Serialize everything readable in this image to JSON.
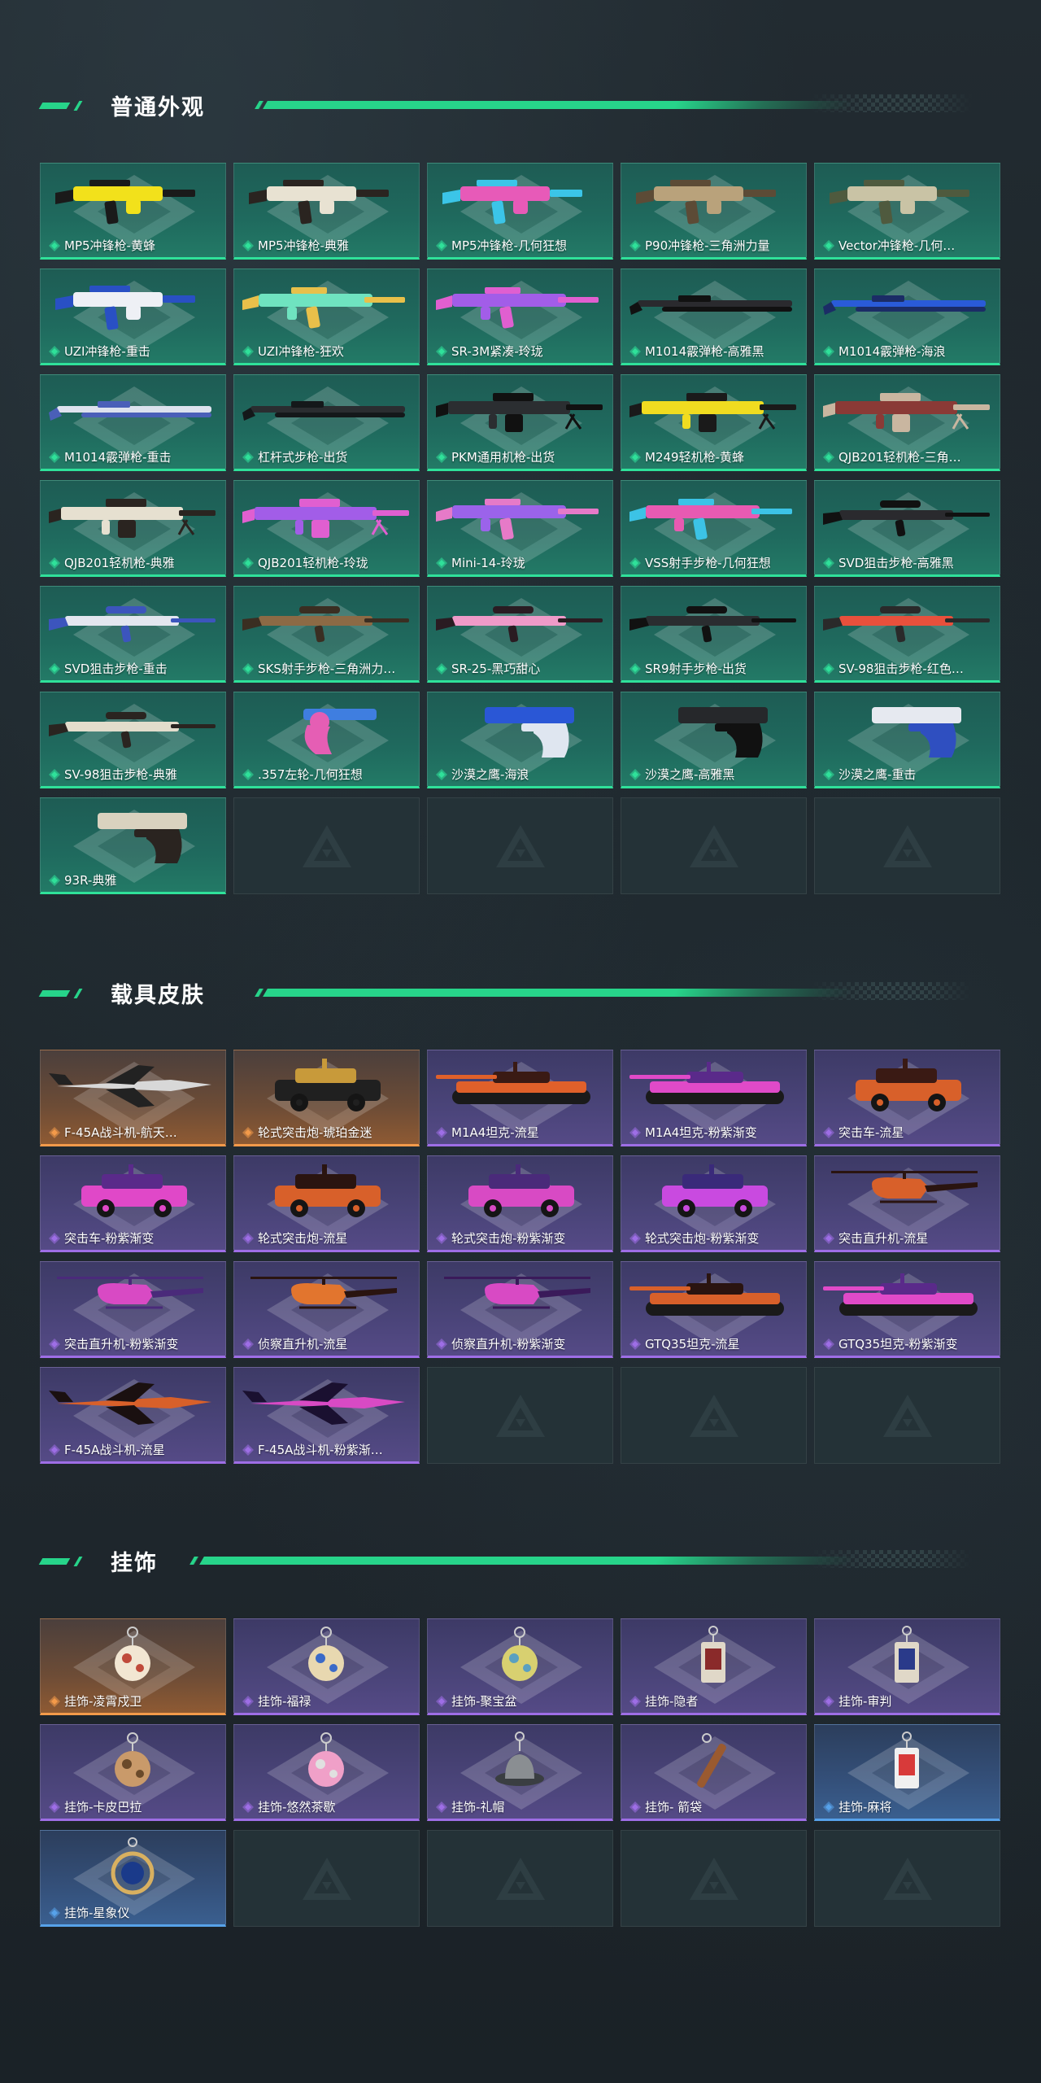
{
  "sections": [
    {
      "title": "普通外观",
      "items": [
        {
          "label": "MP5冲锋枪-黄蜂",
          "rarity": "green",
          "icon": "smg",
          "colors": [
            "#f2e11b",
            "#1a1a1a"
          ]
        },
        {
          "label": "MP5冲锋枪-典雅",
          "rarity": "green",
          "icon": "smg",
          "colors": [
            "#e8e2d2",
            "#2a2420"
          ]
        },
        {
          "label": "MP5冲锋枪-几何狂想",
          "rarity": "green",
          "icon": "smg",
          "colors": [
            "#e75ab8",
            "#3bc5e8"
          ]
        },
        {
          "label": "P90冲锋枪-三角洲力量",
          "rarity": "green",
          "icon": "smg",
          "colors": [
            "#b9a27b",
            "#5c4b36"
          ]
        },
        {
          "label": "Vector冲锋枪-几何…",
          "rarity": "green",
          "icon": "smg",
          "colors": [
            "#c9c3a5",
            "#4f5a3e"
          ]
        },
        {
          "label": "UZI冲锋枪-重击",
          "rarity": "green",
          "icon": "smg",
          "colors": [
            "#eef0f5",
            "#2950c4"
          ]
        },
        {
          "label": "UZI冲锋枪-狂欢",
          "rarity": "green",
          "icon": "rifle",
          "colors": [
            "#6fe3c0",
            "#e8c04a"
          ]
        },
        {
          "label": "SR-3M紧凑-玲珑",
          "rarity": "green",
          "icon": "rifle",
          "colors": [
            "#a25de8",
            "#e05fd0"
          ]
        },
        {
          "label": "M1014霰弹枪-高雅黑",
          "rarity": "green",
          "icon": "shotgun",
          "colors": [
            "#2a2a2e",
            "#111"
          ]
        },
        {
          "label": "M1014霰弹枪-海浪",
          "rarity": "green",
          "icon": "shotgun",
          "colors": [
            "#2a5bd8",
            "#1b2c66"
          ]
        },
        {
          "label": "M1014霰弹枪-重击",
          "rarity": "green",
          "icon": "shotgun",
          "colors": [
            "#dde2ee",
            "#4a5fb8"
          ]
        },
        {
          "label": "杠杆式步枪-出货",
          "rarity": "green",
          "icon": "shotgun",
          "colors": [
            "#2a2d30",
            "#14181a"
          ]
        },
        {
          "label": "PKM通用机枪-出货",
          "rarity": "green",
          "icon": "lmg",
          "colors": [
            "#2b2e31",
            "#111"
          ]
        },
        {
          "label": "M249轻机枪-黄蜂",
          "rarity": "green",
          "icon": "lmg",
          "colors": [
            "#f0dc20",
            "#1a1a1a"
          ]
        },
        {
          "label": "QJB201轻机枪-三角…",
          "rarity": "green",
          "icon": "lmg",
          "colors": [
            "#8a3a36",
            "#c9b6a0"
          ]
        },
        {
          "label": "QJB201轻机枪-典雅",
          "rarity": "green",
          "icon": "lmg",
          "colors": [
            "#e6e0d0",
            "#2a2420"
          ]
        },
        {
          "label": "QJB201轻机枪-玲珑",
          "rarity": "green",
          "icon": "lmg",
          "colors": [
            "#a25de8",
            "#e05fd0"
          ]
        },
        {
          "label": "Mini-14-玲珑",
          "rarity": "green",
          "icon": "rifle",
          "colors": [
            "#9b63ea",
            "#e67ac8"
          ]
        },
        {
          "label": "VSS射手步枪-几何狂想",
          "rarity": "green",
          "icon": "rifle",
          "colors": [
            "#e85ab2",
            "#3cc3e6"
          ]
        },
        {
          "label": "SVD狙击步枪-高雅黑",
          "rarity": "green",
          "icon": "sniper",
          "colors": [
            "#2a2a2e",
            "#111"
          ]
        },
        {
          "label": "SVD狙击步枪-重击",
          "rarity": "green",
          "icon": "sniper",
          "colors": [
            "#e3e6ef",
            "#3c55bd"
          ]
        },
        {
          "label": "SKS射手步枪-三角洲力…",
          "rarity": "green",
          "icon": "sniper",
          "colors": [
            "#8c6a45",
            "#3a2e22"
          ]
        },
        {
          "label": "SR-25-黑巧甜心",
          "rarity": "green",
          "icon": "sniper",
          "colors": [
            "#ef9ac8",
            "#2a1c22"
          ]
        },
        {
          "label": "SR9射手步枪-出货",
          "rarity": "green",
          "icon": "sniper",
          "colors": [
            "#2a2d30",
            "#111"
          ]
        },
        {
          "label": "SV-98狙击步枪-红色…",
          "rarity": "green",
          "icon": "sniper",
          "colors": [
            "#e8503c",
            "#2a2a2a"
          ]
        },
        {
          "label": "SV-98狙击步枪-典雅",
          "rarity": "green",
          "icon": "sniper",
          "colors": [
            "#e3ddcc",
            "#2a2420"
          ]
        },
        {
          "label": ".357左轮-几何狂想",
          "rarity": "green",
          "icon": "revolver",
          "colors": [
            "#3f7ee0",
            "#e55eb4"
          ]
        },
        {
          "label": "沙漠之鹰-海浪",
          "rarity": "green",
          "icon": "pistol",
          "colors": [
            "#2a57d6",
            "#dfe6f0"
          ]
        },
        {
          "label": "沙漠之鹰-高雅黑",
          "rarity": "green",
          "icon": "pistol",
          "colors": [
            "#26282b",
            "#111"
          ]
        },
        {
          "label": "沙漠之鹰-重击",
          "rarity": "green",
          "icon": "pistol",
          "colors": [
            "#e6e9f0",
            "#2f4fc0"
          ]
        },
        {
          "label": "93R-典雅",
          "rarity": "green",
          "icon": "pistol",
          "colors": [
            "#d9d2bf",
            "#2a2420"
          ]
        }
      ],
      "empty_slots": 4
    },
    {
      "title": "载具皮肤",
      "items": [
        {
          "label": "F-45A战斗机-航天…",
          "rarity": "orange",
          "icon": "jet",
          "colors": [
            "#d8d8d8",
            "#222"
          ]
        },
        {
          "label": "轮式突击炮-琥珀金迷",
          "rarity": "orange",
          "icon": "car",
          "colors": [
            "#202020",
            "#c89a3a"
          ]
        },
        {
          "label": "M1A4坦克-流星",
          "rarity": "purple",
          "icon": "tank",
          "colors": [
            "#e0602a",
            "#3a1a14"
          ]
        },
        {
          "label": "M1A4坦克-粉紫渐变",
          "rarity": "purple",
          "icon": "tank",
          "colors": [
            "#e04ac8",
            "#5a2a8a"
          ]
        },
        {
          "label": "突击车-流星",
          "rarity": "purple",
          "icon": "car",
          "colors": [
            "#d8602a",
            "#3a1a14"
          ]
        },
        {
          "label": "突击车-粉紫渐变",
          "rarity": "purple",
          "icon": "car",
          "colors": [
            "#e048c8",
            "#5a2a8a"
          ]
        },
        {
          "label": "轮式突击炮-流星",
          "rarity": "purple",
          "icon": "car",
          "colors": [
            "#d8602a",
            "#2a1410"
          ]
        },
        {
          "label": "轮式突击炮-粉紫渐变",
          "rarity": "purple",
          "icon": "car",
          "colors": [
            "#d84ac4",
            "#4a2a7a"
          ]
        },
        {
          "label": "轮式突击炮-粉紫渐变",
          "rarity": "purple",
          "icon": "car",
          "colors": [
            "#c94ae0",
            "#3a2a7a"
          ]
        },
        {
          "label": "突击直升机-流星",
          "rarity": "purple",
          "icon": "heli",
          "colors": [
            "#d8602a",
            "#2a1410"
          ]
        },
        {
          "label": "突击直升机-粉紫渐变",
          "rarity": "purple",
          "icon": "heli",
          "colors": [
            "#d84ac4",
            "#4a2a7a"
          ]
        },
        {
          "label": "侦察直升机-流星",
          "rarity": "purple",
          "icon": "heli",
          "colors": [
            "#e2752e",
            "#2a1410"
          ]
        },
        {
          "label": "侦察直升机-粉紫渐变",
          "rarity": "purple",
          "icon": "heli",
          "colors": [
            "#d84ac4",
            "#3a1a5a"
          ]
        },
        {
          "label": "GTQ35坦克-流星",
          "rarity": "purple",
          "icon": "tank",
          "colors": [
            "#d8602a",
            "#2a1410"
          ]
        },
        {
          "label": "GTQ35坦克-粉紫渐变",
          "rarity": "purple",
          "icon": "tank",
          "colors": [
            "#e04ac8",
            "#5a2a8a"
          ]
        },
        {
          "label": "F-45A战斗机-流星",
          "rarity": "purple",
          "icon": "jet",
          "colors": [
            "#d8602a",
            "#1a1010"
          ]
        },
        {
          "label": "F-45A战斗机-粉紫渐…",
          "rarity": "purple",
          "icon": "jet",
          "colors": [
            "#d84ac4",
            "#1a1030"
          ]
        }
      ],
      "empty_slots": 3
    },
    {
      "title": "挂饰",
      "items": [
        {
          "label": "挂饰-凌霄戍卫",
          "rarity": "orange",
          "icon": "charm",
          "colors": [
            "#f2e6d2",
            "#c04a3a"
          ]
        },
        {
          "label": "挂饰-福禄",
          "rarity": "purple",
          "icon": "charm",
          "colors": [
            "#e8d8b0",
            "#3a6ac8"
          ]
        },
        {
          "label": "挂饰-聚宝盆",
          "rarity": "purple",
          "icon": "charm",
          "colors": [
            "#d8d070",
            "#5aa0c0"
          ]
        },
        {
          "label": "挂饰-隐者",
          "rarity": "purple",
          "icon": "card",
          "colors": [
            "#e0d8c8",
            "#8a2a2a"
          ]
        },
        {
          "label": "挂饰-审判",
          "rarity": "purple",
          "icon": "card",
          "colors": [
            "#e0d8c8",
            "#2a3a8a"
          ]
        },
        {
          "label": "挂饰-卡皮巴拉",
          "rarity": "purple",
          "icon": "charm",
          "colors": [
            "#c99a6a",
            "#6a4a2a"
          ]
        },
        {
          "label": "挂饰-悠然茶歇",
          "rarity": "purple",
          "icon": "charm",
          "colors": [
            "#f0a0c8",
            "#e0e0e0"
          ]
        },
        {
          "label": "挂饰-礼帽",
          "rarity": "purple",
          "icon": "hat",
          "colors": [
            "#8a8e92",
            "#3a3e42"
          ]
        },
        {
          "label": "挂饰- 箭袋",
          "rarity": "purple",
          "icon": "stick",
          "colors": [
            "#9a5a30",
            "#3a2418"
          ]
        },
        {
          "label": "挂饰-麻将",
          "rarity": "blue",
          "icon": "card",
          "colors": [
            "#f0f0f0",
            "#d83a3a"
          ]
        },
        {
          "label": "挂饰-星象仪",
          "rarity": "blue",
          "icon": "ring",
          "colors": [
            "#d8b060",
            "#1a3a8a"
          ]
        }
      ],
      "empty_slots": 4
    }
  ],
  "rarity_colors": {
    "green": "#2fe19a",
    "purple": "#9e6ee6",
    "orange": "#f39a4a",
    "blue": "#57a2ea"
  }
}
